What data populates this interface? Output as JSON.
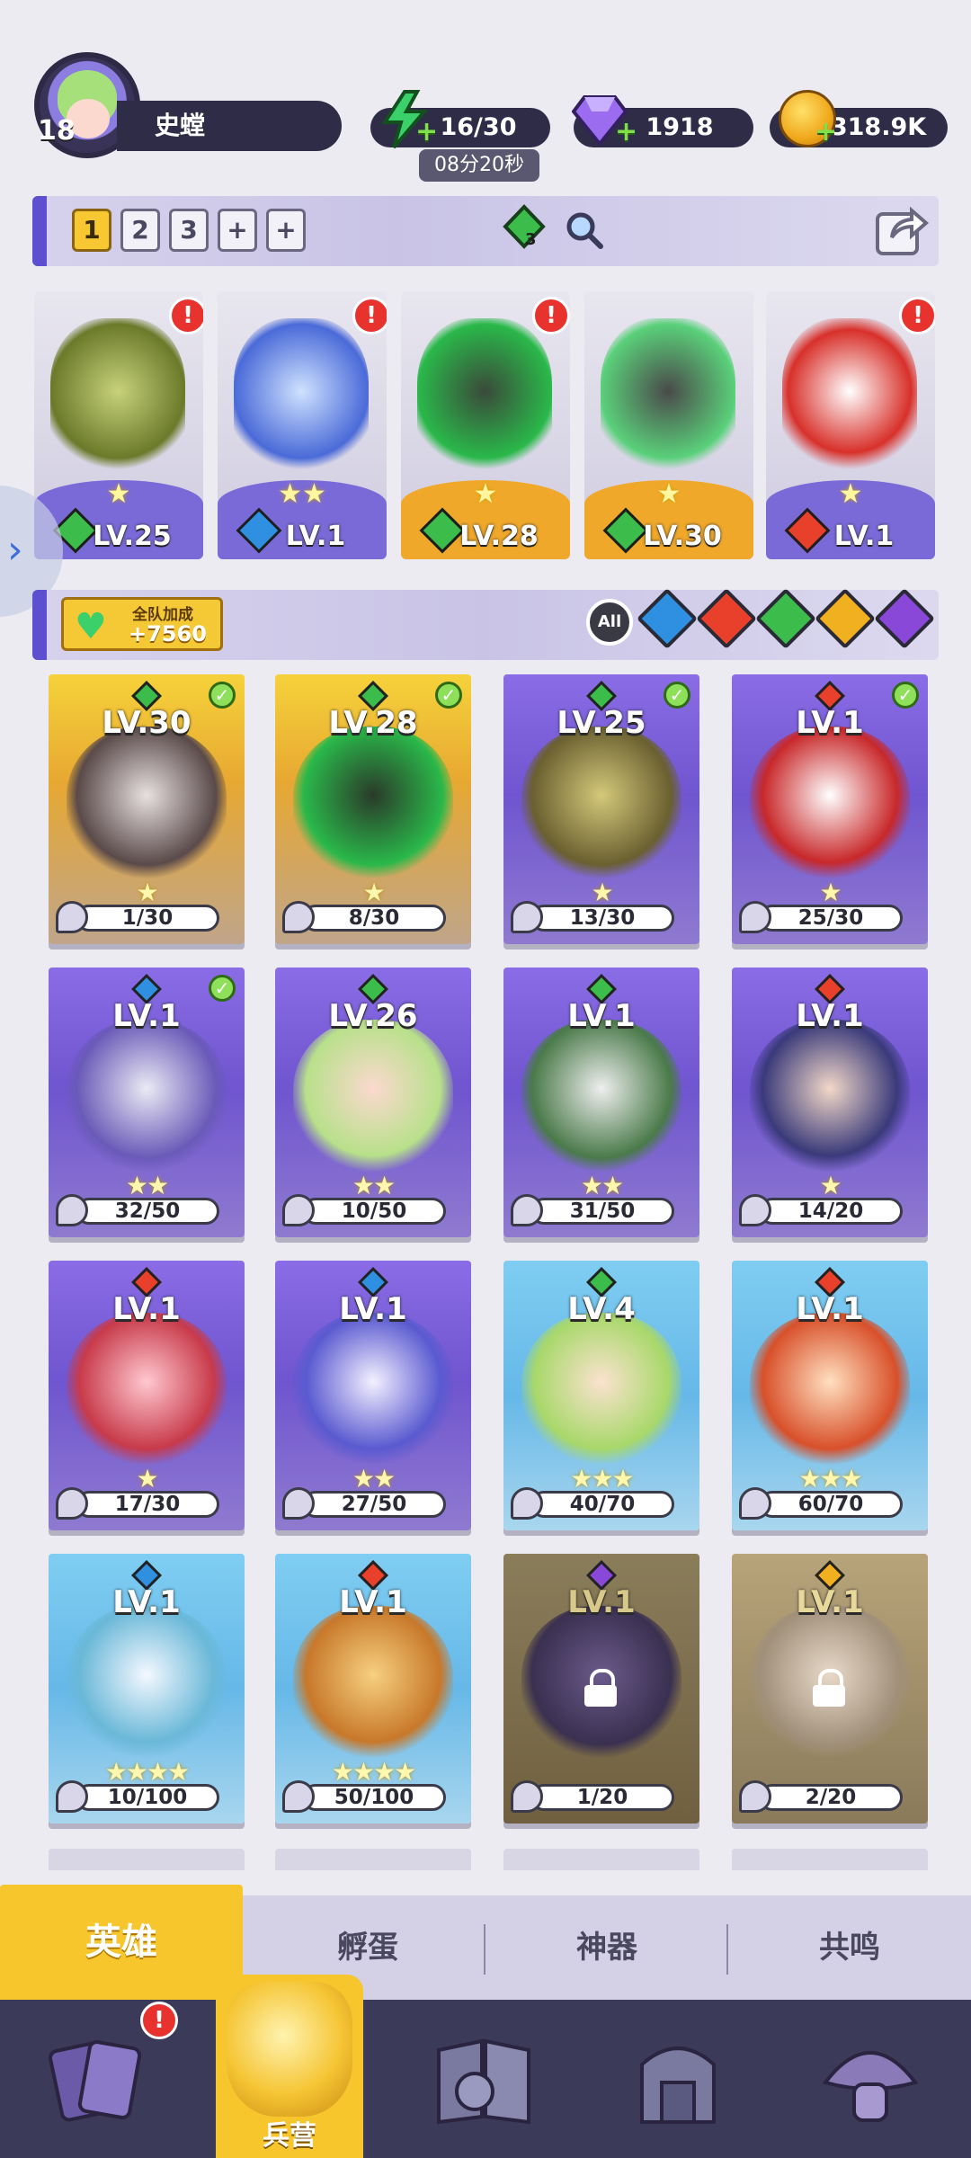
{
  "player": {
    "level": "18",
    "name": "史螳"
  },
  "resources": {
    "energy": "16/30",
    "energy_timer": "08分20秒",
    "gems": "1918",
    "gold": "318.9K"
  },
  "team_bar": {
    "slots": [
      "1",
      "2",
      "3",
      "+",
      "+"
    ],
    "active_slot": "1",
    "gem_count": "3"
  },
  "team_cards": [
    {
      "level": "LV.25",
      "stars": "★",
      "element": "wind",
      "alert": "!"
    },
    {
      "level": "LV.1",
      "stars": "★★",
      "element": "water",
      "alert": "!"
    },
    {
      "level": "LV.28",
      "stars": "★",
      "element": "wind",
      "alert": "!"
    },
    {
      "level": "LV.30",
      "stars": "★",
      "element": "wind",
      "alert": ""
    },
    {
      "level": "LV.1",
      "stars": "★",
      "element": "fire",
      "alert": "!"
    }
  ],
  "filter_bar": {
    "bonus_label": "全队加成",
    "bonus_value": "+7560",
    "all_label": "All"
  },
  "heroes": [
    {
      "level": "LV.30",
      "progress": "1/30",
      "stars": "★",
      "checked": true
    },
    {
      "level": "LV.28",
      "progress": "8/30",
      "stars": "★",
      "checked": true
    },
    {
      "level": "LV.25",
      "progress": "13/30",
      "stars": "★",
      "checked": true
    },
    {
      "level": "LV.1",
      "progress": "25/30",
      "stars": "★",
      "checked": true
    },
    {
      "level": "LV.1",
      "progress": "32/50",
      "stars": "★★",
      "checked": true
    },
    {
      "level": "LV.26",
      "progress": "10/50",
      "stars": "★★",
      "checked": false
    },
    {
      "level": "LV.1",
      "progress": "31/50",
      "stars": "★★",
      "checked": false
    },
    {
      "level": "LV.1",
      "progress": "14/20",
      "stars": "★",
      "checked": false
    },
    {
      "level": "LV.1",
      "progress": "17/30",
      "stars": "★",
      "checked": false
    },
    {
      "level": "LV.1",
      "progress": "27/50",
      "stars": "★★",
      "checked": false
    },
    {
      "level": "LV.4",
      "progress": "40/70",
      "stars": "★★★",
      "checked": false
    },
    {
      "level": "LV.1",
      "progress": "60/70",
      "stars": "★★★",
      "checked": false
    },
    {
      "level": "LV.1",
      "progress": "10/100",
      "stars": "★★★★",
      "checked": false
    },
    {
      "level": "LV.1",
      "progress": "50/100",
      "stars": "★★★★",
      "checked": false
    },
    {
      "level": "LV.1",
      "progress": "1/20",
      "stars": "",
      "checked": false
    },
    {
      "level": "LV.1",
      "progress": "2/20",
      "stars": "",
      "checked": false
    }
  ],
  "sub_tabs": [
    "英雄",
    "孵蛋",
    "神器",
    "共鸣"
  ],
  "nav": {
    "active_label": "兵营",
    "alert": "!"
  },
  "colors": {
    "accent_yellow": "#f7c62c",
    "nav_bg": "#3b3a58",
    "wind": "#3cbc4a",
    "water": "#2f8fe0",
    "fire": "#e8402a",
    "light": "#f0b020",
    "dark": "#8a48d8"
  }
}
